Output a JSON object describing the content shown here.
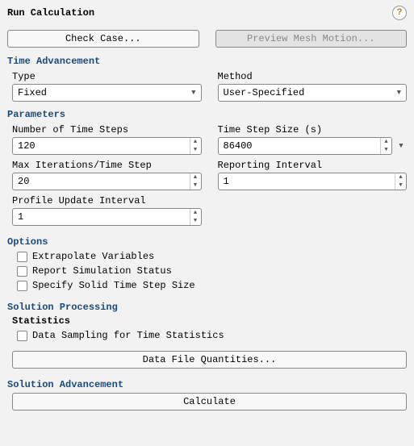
{
  "title": "Run Calculation",
  "buttons": {
    "check_case": "Check Case...",
    "preview_mesh": "Preview Mesh Motion...",
    "data_file_quantities": "Data File Quantities...",
    "calculate": "Calculate"
  },
  "sections": {
    "time_advancement": "Time Advancement",
    "parameters": "Parameters",
    "options": "Options",
    "solution_processing": "Solution Processing",
    "statistics": "Statistics",
    "solution_advancement": "Solution Advancement"
  },
  "time_advancement": {
    "type_label": "Type",
    "type_value": "Fixed",
    "method_label": "Method",
    "method_value": "User-Specified"
  },
  "parameters": {
    "num_steps_label": "Number of Time Steps",
    "num_steps_value": "120",
    "time_step_size_label": "Time Step Size (s)",
    "time_step_size_value": "86400",
    "max_iter_label": "Max Iterations/Time Step",
    "max_iter_value": "20",
    "reporting_interval_label": "Reporting Interval",
    "reporting_interval_value": "1",
    "profile_update_label": "Profile Update Interval",
    "profile_update_value": "1"
  },
  "options": {
    "extrapolate": "Extrapolate Variables",
    "report_sim": "Report Simulation Status",
    "specify_solid": "Specify Solid Time Step Size"
  },
  "statistics": {
    "data_sampling": "Data Sampling for Time Statistics"
  }
}
